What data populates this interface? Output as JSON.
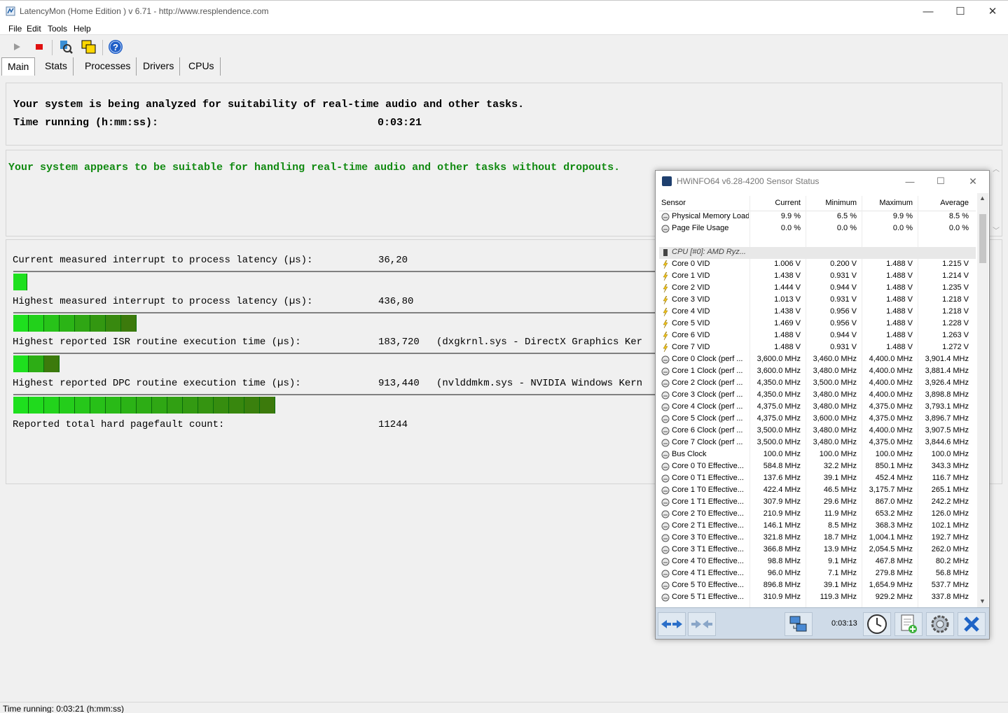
{
  "window": {
    "title": "LatencyMon  (Home Edition )  v 6.71 - http://www.resplendence.com",
    "minimize": "—",
    "maximize": "☐",
    "close": "✕"
  },
  "menu": [
    "File",
    "Edit",
    "Tools",
    "Help"
  ],
  "toolbar": {
    "icons": [
      "play-icon",
      "stop-icon",
      "analyze-icon",
      "windows-icon",
      "help-icon"
    ]
  },
  "tabs": [
    "Main",
    "Stats",
    "Processes",
    "Drivers",
    "CPUs"
  ],
  "status_header": {
    "line1": "Your system is being analyzed for suitability of real-time audio and other tasks.",
    "time_label": "Time running (h:mm:ss):",
    "time_value": "0:03:21"
  },
  "verdict": "Your system appears to be suitable for handling real-time audio and other tasks without dropouts.",
  "metrics": [
    {
      "label": "Current measured interrupt to process latency (µs):",
      "value": "36,20",
      "extra": "",
      "bar_segments": 1
    },
    {
      "label": "Highest measured interrupt to process latency (µs):",
      "value": "436,80",
      "extra": "",
      "bar_segments": 8
    },
    {
      "label": "Highest reported ISR routine execution time (µs):",
      "value": "183,720",
      "extra": "(dxgkrnl.sys - DirectX Graphics Ker",
      "bar_segments": 3
    },
    {
      "label": "Highest reported DPC routine execution time (µs):",
      "value": "913,440",
      "extra": "(nvlddmkm.sys - NVIDIA Windows Kern",
      "bar_segments": 17
    },
    {
      "label": "Reported total hard pagefault count:",
      "value": "11244",
      "extra": "",
      "bar_segments": 0
    }
  ],
  "statusbar": "Time running: 0:03:21  (h:mm:ss)",
  "hwinfo": {
    "title": "HWiNFO64 v6.28-4200 Sensor Status",
    "columns": [
      "Sensor",
      "Current",
      "Minimum",
      "Maximum",
      "Average"
    ],
    "rows": [
      {
        "icon": "gauge",
        "name": "Physical Memory Load",
        "cur": "9.9 %",
        "min": "6.5 %",
        "max": "9.9 %",
        "avg": "8.5 %"
      },
      {
        "icon": "gauge",
        "name": "Page File Usage",
        "cur": "0.0 %",
        "min": "0.0 %",
        "max": "0.0 %",
        "avg": "0.0 %"
      },
      {
        "icon": "blank",
        "name": "",
        "cur": "",
        "min": "",
        "max": "",
        "avg": ""
      },
      {
        "icon": "chip",
        "name": "CPU [#0]: AMD Ryz...",
        "cur": "",
        "min": "",
        "max": "",
        "avg": "",
        "group": true
      },
      {
        "icon": "bolt",
        "name": "Core 0 VID",
        "cur": "1.006 V",
        "min": "0.200 V",
        "max": "1.488 V",
        "avg": "1.215 V"
      },
      {
        "icon": "bolt",
        "name": "Core 1 VID",
        "cur": "1.438 V",
        "min": "0.931 V",
        "max": "1.488 V",
        "avg": "1.214 V"
      },
      {
        "icon": "bolt",
        "name": "Core 2 VID",
        "cur": "1.444 V",
        "min": "0.944 V",
        "max": "1.488 V",
        "avg": "1.235 V"
      },
      {
        "icon": "bolt",
        "name": "Core 3 VID",
        "cur": "1.013 V",
        "min": "0.931 V",
        "max": "1.488 V",
        "avg": "1.218 V"
      },
      {
        "icon": "bolt",
        "name": "Core 4 VID",
        "cur": "1.438 V",
        "min": "0.956 V",
        "max": "1.488 V",
        "avg": "1.218 V"
      },
      {
        "icon": "bolt",
        "name": "Core 5 VID",
        "cur": "1.469 V",
        "min": "0.956 V",
        "max": "1.488 V",
        "avg": "1.228 V"
      },
      {
        "icon": "bolt",
        "name": "Core 6 VID",
        "cur": "1.488 V",
        "min": "0.944 V",
        "max": "1.488 V",
        "avg": "1.263 V"
      },
      {
        "icon": "bolt",
        "name": "Core 7 VID",
        "cur": "1.488 V",
        "min": "0.931 V",
        "max": "1.488 V",
        "avg": "1.272 V"
      },
      {
        "icon": "gauge",
        "name": "Core 0 Clock (perf ...",
        "cur": "3,600.0 MHz",
        "min": "3,460.0 MHz",
        "max": "4,400.0 MHz",
        "avg": "3,901.4 MHz"
      },
      {
        "icon": "gauge",
        "name": "Core 1 Clock (perf ...",
        "cur": "3,600.0 MHz",
        "min": "3,480.0 MHz",
        "max": "4,400.0 MHz",
        "avg": "3,881.4 MHz"
      },
      {
        "icon": "gauge",
        "name": "Core 2 Clock (perf ...",
        "cur": "4,350.0 MHz",
        "min": "3,500.0 MHz",
        "max": "4,400.0 MHz",
        "avg": "3,926.4 MHz"
      },
      {
        "icon": "gauge",
        "name": "Core 3 Clock (perf ...",
        "cur": "4,350.0 MHz",
        "min": "3,480.0 MHz",
        "max": "4,400.0 MHz",
        "avg": "3,898.8 MHz"
      },
      {
        "icon": "gauge",
        "name": "Core 4 Clock (perf ...",
        "cur": "4,375.0 MHz",
        "min": "3,480.0 MHz",
        "max": "4,375.0 MHz",
        "avg": "3,793.1 MHz"
      },
      {
        "icon": "gauge",
        "name": "Core 5 Clock (perf ...",
        "cur": "4,375.0 MHz",
        "min": "3,600.0 MHz",
        "max": "4,375.0 MHz",
        "avg": "3,896.7 MHz"
      },
      {
        "icon": "gauge",
        "name": "Core 6 Clock (perf ...",
        "cur": "3,500.0 MHz",
        "min": "3,480.0 MHz",
        "max": "4,400.0 MHz",
        "avg": "3,907.5 MHz"
      },
      {
        "icon": "gauge",
        "name": "Core 7 Clock (perf ...",
        "cur": "3,500.0 MHz",
        "min": "3,480.0 MHz",
        "max": "4,375.0 MHz",
        "avg": "3,844.6 MHz"
      },
      {
        "icon": "gauge",
        "name": "Bus Clock",
        "cur": "100.0 MHz",
        "min": "100.0 MHz",
        "max": "100.0 MHz",
        "avg": "100.0 MHz"
      },
      {
        "icon": "gauge",
        "name": "Core 0 T0 Effective...",
        "cur": "584.8 MHz",
        "min": "32.2 MHz",
        "max": "850.1 MHz",
        "avg": "343.3 MHz"
      },
      {
        "icon": "gauge",
        "name": "Core 0 T1 Effective...",
        "cur": "137.6 MHz",
        "min": "39.1 MHz",
        "max": "452.4 MHz",
        "avg": "116.7 MHz"
      },
      {
        "icon": "gauge",
        "name": "Core 1 T0 Effective...",
        "cur": "422.4 MHz",
        "min": "46.5 MHz",
        "max": "3,175.7 MHz",
        "avg": "265.1 MHz"
      },
      {
        "icon": "gauge",
        "name": "Core 1 T1 Effective...",
        "cur": "307.9 MHz",
        "min": "29.6 MHz",
        "max": "867.0 MHz",
        "avg": "242.2 MHz"
      },
      {
        "icon": "gauge",
        "name": "Core 2 T0 Effective...",
        "cur": "210.9 MHz",
        "min": "11.9 MHz",
        "max": "653.2 MHz",
        "avg": "126.0 MHz"
      },
      {
        "icon": "gauge",
        "name": "Core 2 T1 Effective...",
        "cur": "146.1 MHz",
        "min": "8.5 MHz",
        "max": "368.3 MHz",
        "avg": "102.1 MHz"
      },
      {
        "icon": "gauge",
        "name": "Core 3 T0 Effective...",
        "cur": "321.8 MHz",
        "min": "18.7 MHz",
        "max": "1,004.1 MHz",
        "avg": "192.7 MHz"
      },
      {
        "icon": "gauge",
        "name": "Core 3 T1 Effective...",
        "cur": "366.8 MHz",
        "min": "13.9 MHz",
        "max": "2,054.5 MHz",
        "avg": "262.0 MHz"
      },
      {
        "icon": "gauge",
        "name": "Core 4 T0 Effective...",
        "cur": "98.8 MHz",
        "min": "9.1 MHz",
        "max": "467.8 MHz",
        "avg": "80.2 MHz"
      },
      {
        "icon": "gauge",
        "name": "Core 4 T1 Effective...",
        "cur": "96.0 MHz",
        "min": "7.1 MHz",
        "max": "279.8 MHz",
        "avg": "56.8 MHz"
      },
      {
        "icon": "gauge",
        "name": "Core 5 T0 Effective...",
        "cur": "896.8 MHz",
        "min": "39.1 MHz",
        "max": "1,654.9 MHz",
        "avg": "537.7 MHz"
      },
      {
        "icon": "gauge",
        "name": "Core 5 T1 Effective...",
        "cur": "310.9 MHz",
        "min": "119.3 MHz",
        "max": "929.2 MHz",
        "avg": "337.8 MHz"
      }
    ],
    "footer_time": "0:03:13",
    "footer_icons": [
      "expand-arrows-icon",
      "collapse-arrows-icon",
      "network-icon",
      "clock-icon",
      "report-icon",
      "settings-icon",
      "close-x-icon"
    ]
  },
  "colors": {
    "bar_green_bright": "#1ee01e",
    "bar_green_dark": "#3c7a0c",
    "verdict_green": "#118a11"
  }
}
